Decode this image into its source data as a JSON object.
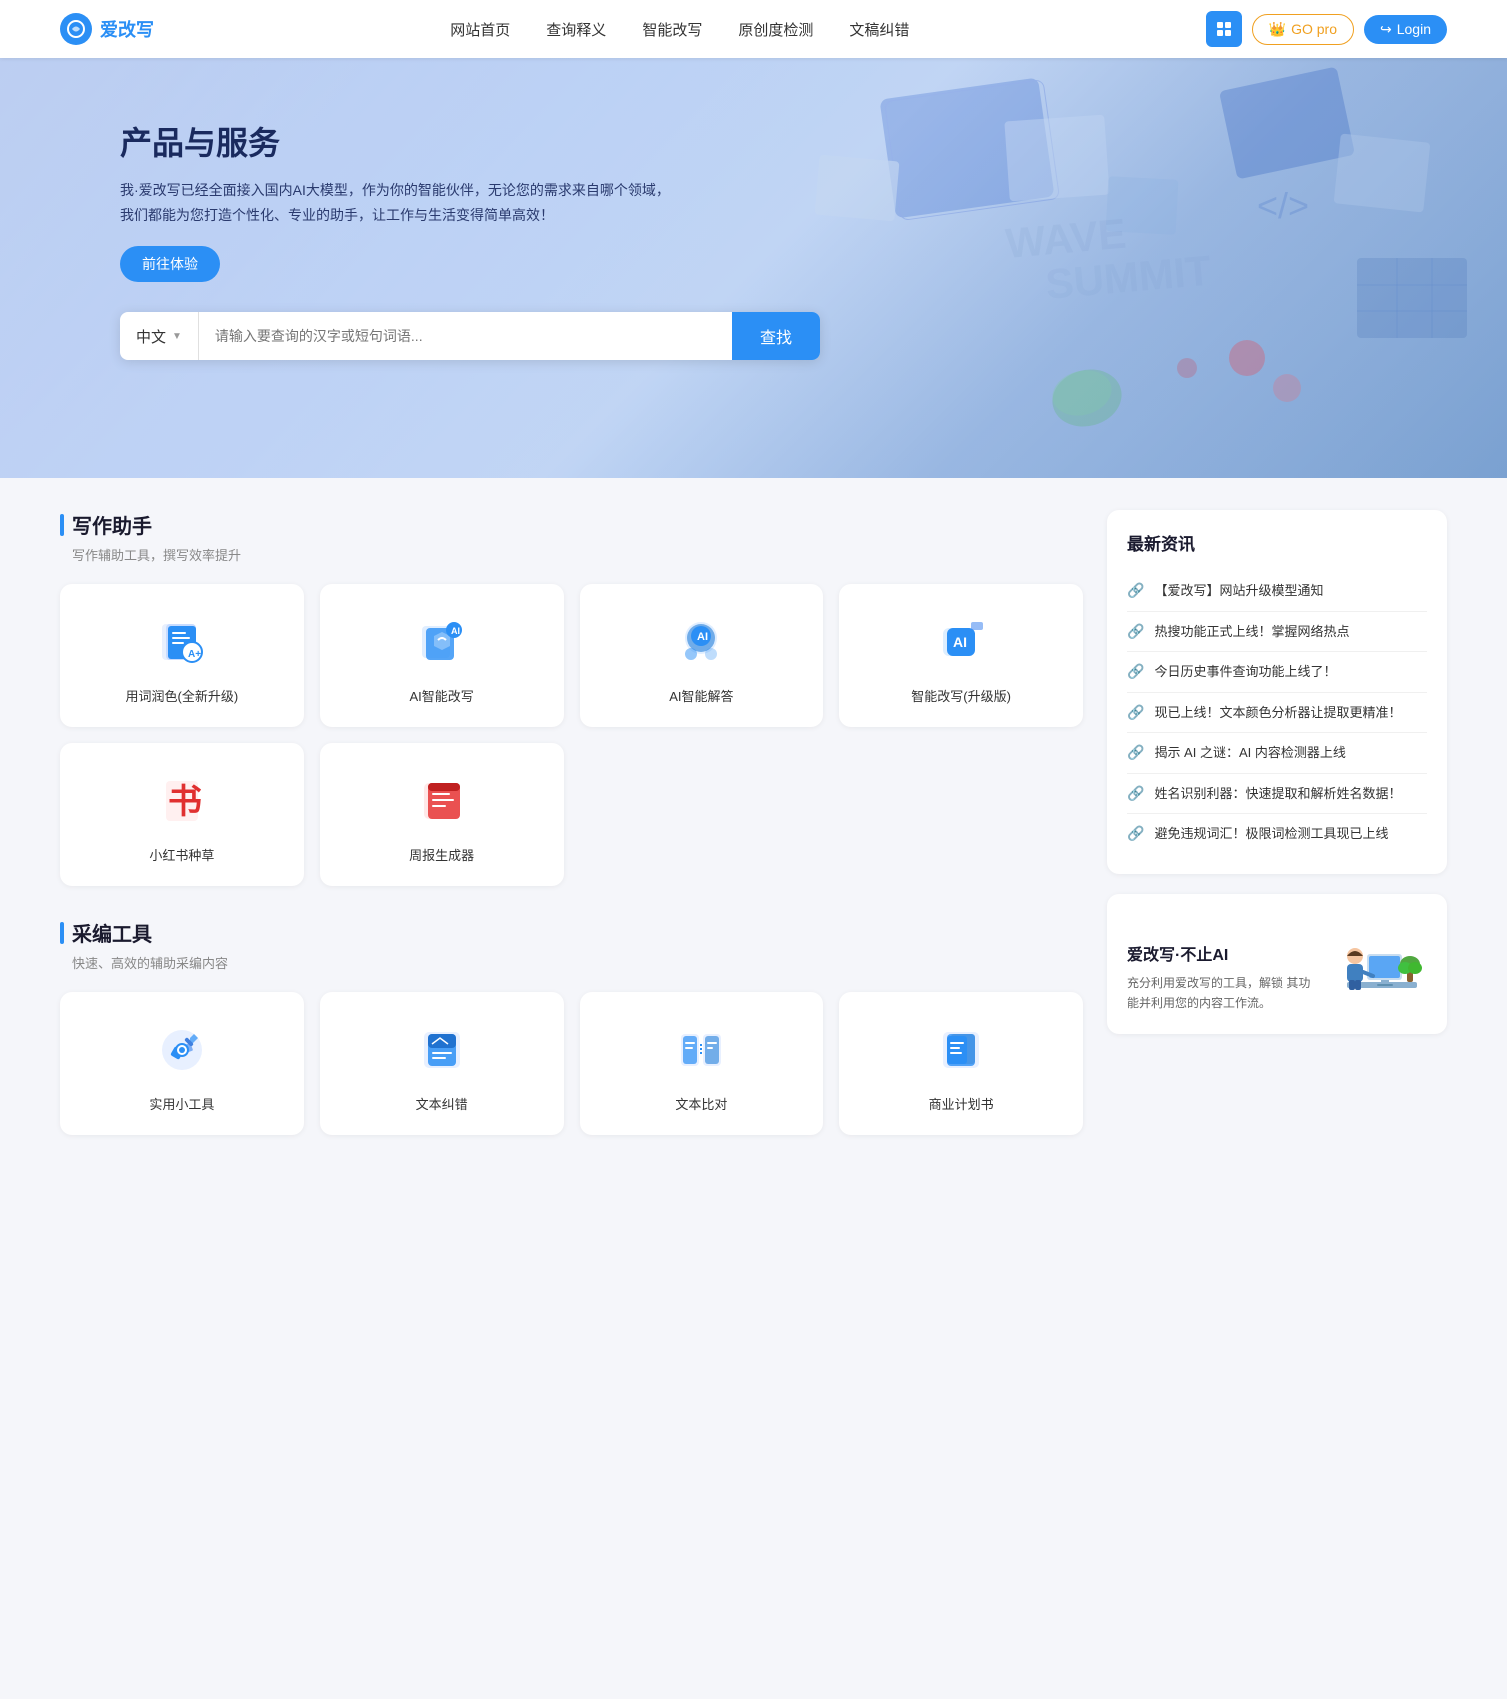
{
  "nav": {
    "logo_text": "爱改写",
    "links": [
      "网站首页",
      "查询释义",
      "智能改写",
      "原创度检测",
      "文稿纠错"
    ],
    "btn_grid_label": "Grid",
    "btn_go_pro": "GO pro",
    "btn_login": "Login"
  },
  "hero": {
    "title": "产品与服务",
    "desc": "我·爱改写已经全面接入国内AI大模型，作为你的智能伙伴，无论您的需求来自哪个领域，我们都能为您打造个性化、专业的助手，让工作与生活变得简单高效！",
    "btn_try": "前往体验",
    "search": {
      "lang": "中文",
      "placeholder": "请输入要查询的汉字或短句词语...",
      "btn": "查找"
    }
  },
  "writing": {
    "section_title": "写作助手",
    "section_desc": "写作辅助工具，撰写效率提升",
    "cards": [
      {
        "label": "用词润色(全新升级)",
        "icon": "writing-polish"
      },
      {
        "label": "AI智能改写",
        "icon": "ai-rewrite"
      },
      {
        "label": "AI智能解答",
        "icon": "ai-answer"
      },
      {
        "label": "智能改写(升级版)",
        "icon": "smart-rewrite"
      },
      {
        "label": "小红书种草",
        "icon": "xiaohongshu"
      },
      {
        "label": "周报生成器",
        "icon": "weekly-report"
      }
    ]
  },
  "tools": {
    "section_title": "采编工具",
    "section_desc": "快速、高效的辅助采编内容",
    "cards": [
      {
        "label": "实用小工具",
        "icon": "utility-tools"
      },
      {
        "label": "文本纠错",
        "icon": "text-correction"
      },
      {
        "label": "文本比对",
        "icon": "text-compare"
      },
      {
        "label": "商业计划书",
        "icon": "business-plan"
      }
    ]
  },
  "news": {
    "title": "最新资讯",
    "items": [
      "【爱改写】网站升级模型通知",
      "热搜功能正式上线！掌握网络热点",
      "今日历史事件查询功能上线了！",
      "现已上线！文本颜色分析器让提取更精准！",
      "揭示 AI 之谜：AI 内容检测器上线",
      "姓名识别利器：快速提取和解析姓名数据！",
      "避免违规词汇！极限词检测工具现已上线"
    ]
  },
  "promo": {
    "title": "爱改写·不止AI",
    "desc": "充分利用爱改写的工具，解锁\n其功能并利用您的内容工作流。"
  }
}
